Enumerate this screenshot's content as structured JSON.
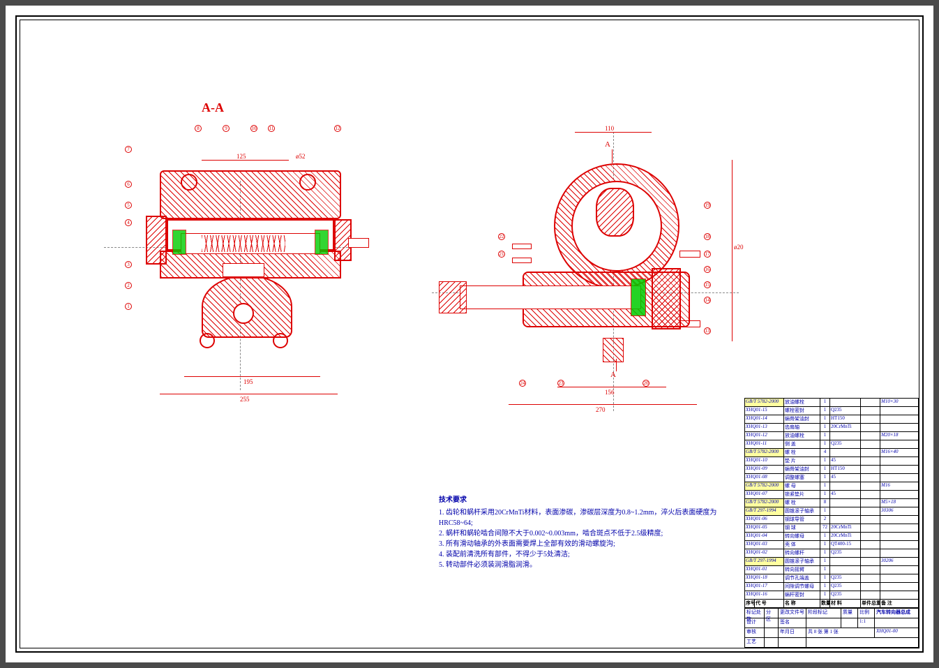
{
  "section_label": "A-A",
  "left_view": {
    "dims": {
      "d1": "125",
      "d2": "ø52",
      "d3": "195",
      "d4": "255"
    },
    "balloons": [
      "1",
      "2",
      "3",
      "4",
      "5",
      "6",
      "7",
      "8",
      "9",
      "10",
      "11",
      "12"
    ]
  },
  "right_view": {
    "dims": {
      "d1": "110",
      "d2": "156",
      "d3": "270",
      "d4": "ø20"
    },
    "balloons": [
      "13",
      "14",
      "15",
      "16",
      "17",
      "18",
      "19",
      "20",
      "21",
      "22",
      "23",
      "24"
    ],
    "section_arrows": [
      "A",
      "A"
    ]
  },
  "notes": {
    "title": "技术要求",
    "items": [
      "1. 齿轮和蜗杆采用20CrMnTi材料，表面渗碳，渗碳层深度为0.8~1.2mm，淬火后表面硬度为HRC58~64;",
      "2. 蜗杆和蜗轮啮合间隙不大于0.002~0.003mm，啮合斑点不低于2.5级精度;",
      "3. 所有滑动轴承的外表面需要焊上全部有效的滑动螺旋沟;",
      "4. 装配前清洗所有部件，不得少于5处清洁;",
      "5. 转动部件必须装润滑脂润滑。"
    ]
  },
  "bom_header": {
    "seq": "序号",
    "code": "代 号",
    "name": "名 称",
    "qty": "数量",
    "mat": "材 料",
    "unit": "单件总重重量",
    "note": "备 注"
  },
  "bom": [
    {
      "code": "GB/T 5782-2000",
      "name": "放油螺栓",
      "qty": "1",
      "mat": "",
      "note": "M10×30",
      "std": true
    },
    {
      "code": "XHQ01-15",
      "name": "螺栓密封",
      "qty": "1",
      "mat": "Q235",
      "note": ""
    },
    {
      "code": "XHQ01-14",
      "name": "蜗骨架油封",
      "qty": "1",
      "mat": "HT150",
      "note": ""
    },
    {
      "code": "XHQ01-13",
      "name": "齿扇轴",
      "qty": "1",
      "mat": "20CrMnTi",
      "note": ""
    },
    {
      "code": "XHQ01-12",
      "name": "放油螺栓",
      "qty": "1",
      "mat": "",
      "note": "M20×18"
    },
    {
      "code": "XHQ01-11",
      "name": "侧 盖",
      "qty": "1",
      "mat": "Q235",
      "note": ""
    },
    {
      "code": "GB/T 5782-2000",
      "name": "螺 栓",
      "qty": "4",
      "mat": "",
      "note": "M16×40",
      "std": true
    },
    {
      "code": "XHQ01-10",
      "name": "垫 片",
      "qty": "1",
      "mat": "45",
      "note": ""
    },
    {
      "code": "XHQ01-09",
      "name": "蜗骨架油封",
      "qty": "1",
      "mat": "HT150",
      "note": ""
    },
    {
      "code": "XHQ01-08",
      "name": "调整螺塞",
      "qty": "1",
      "mat": "45",
      "note": ""
    },
    {
      "code": "GB/T 5782-2000",
      "name": "螺 母",
      "qty": "1",
      "mat": "",
      "note": "M16",
      "std": true
    },
    {
      "code": "XHQ01-07",
      "name": "锁紧垫片",
      "qty": "1",
      "mat": "45",
      "note": ""
    },
    {
      "code": "GB/T 5782-2000",
      "name": "螺 栓",
      "qty": "8",
      "mat": "",
      "note": "M5×18",
      "std": true
    },
    {
      "code": "GB/T 297-1994",
      "name": "圆锥滚子轴承",
      "qty": "1",
      "mat": "",
      "note": "30306",
      "std": true
    },
    {
      "code": "XHQ01-06",
      "name": "钢球导管",
      "qty": "2",
      "mat": "",
      "note": ""
    },
    {
      "code": "XHQ01-05",
      "name": "钢 球",
      "qty": "72",
      "mat": "20CrMnTi",
      "note": ""
    },
    {
      "code": "XHQ01-04",
      "name": "转向螺母",
      "qty": "1",
      "mat": "20CrMnTi",
      "note": ""
    },
    {
      "code": "XHQ01-03",
      "name": "壳 体",
      "qty": "1",
      "mat": "QT400-15",
      "note": ""
    },
    {
      "code": "XHQ01-02",
      "name": "转向螺杆",
      "qty": "1",
      "mat": "Q235",
      "note": ""
    },
    {
      "code": "GB/T 297-1994",
      "name": "圆锥滚子轴承",
      "qty": "1",
      "mat": "",
      "note": "30206",
      "std": true
    },
    {
      "code": "XHQ01-01",
      "name": "转向摇臂",
      "qty": "1",
      "mat": "",
      "note": ""
    },
    {
      "code": "XHQ01-18",
      "name": "调节孔端盖",
      "qty": "1",
      "mat": "Q235",
      "note": ""
    },
    {
      "code": "XHQ01-17",
      "name": "间隙调节螺母",
      "qty": "1",
      "mat": "Q235",
      "note": ""
    },
    {
      "code": "XHQ01-16",
      "name": "蜗杆密封",
      "qty": "1",
      "mat": "Q235",
      "note": ""
    }
  ],
  "titleblock": {
    "title": "汽车转向器总成",
    "dwg_no": "XHQ01-00",
    "scale_label": "比例",
    "scale": "1:1",
    "mass_label": "质量",
    "mass": "",
    "stage_label": "阶段标记",
    "sheet": "共 8 张  第 1 张",
    "rows_left": [
      "标记处数",
      "设计",
      "审核",
      "工艺"
    ],
    "rows_mid": [
      "分 区",
      "",
      "",
      ""
    ],
    "rows_right": [
      "更改文件号",
      "签名",
      "年月日",
      ""
    ]
  }
}
